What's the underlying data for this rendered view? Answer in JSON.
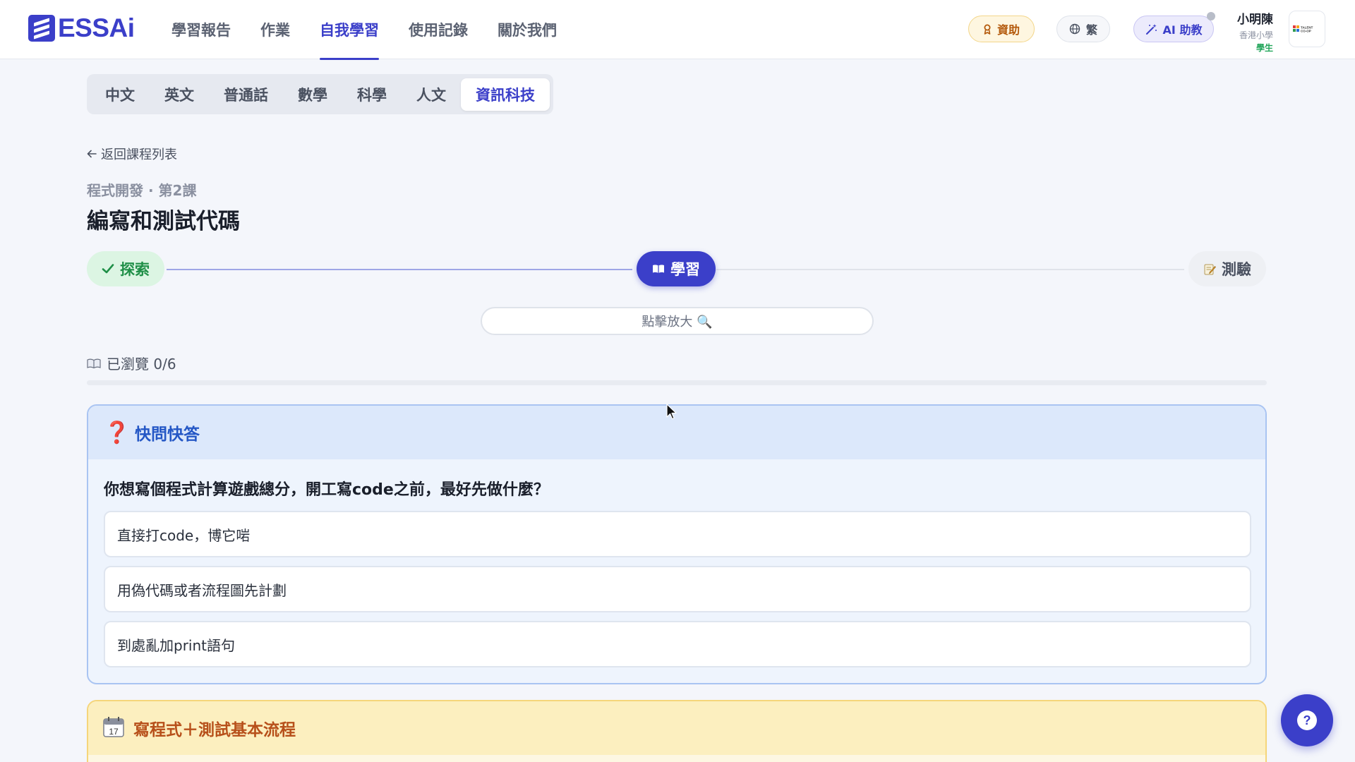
{
  "brand": {
    "logo_text": "ESSAi",
    "accent": "#3b3fc9"
  },
  "nav": {
    "items": [
      {
        "label": "學習報告"
      },
      {
        "label": "作業"
      },
      {
        "label": "自我學習",
        "active": true
      },
      {
        "label": "使用記錄"
      },
      {
        "label": "關於我們"
      }
    ]
  },
  "header_actions": {
    "sponsor_label": "資助",
    "language_label": "繁",
    "ai_tutor_label": "AI 助教"
  },
  "user": {
    "name": "小明陳",
    "school": "香港小學",
    "role": "學生",
    "school_logo_text": "TALENT CO-OP"
  },
  "subject_tabs": [
    {
      "label": "中文"
    },
    {
      "label": "英文"
    },
    {
      "label": "普通話"
    },
    {
      "label": "數學"
    },
    {
      "label": "科學"
    },
    {
      "label": "人文"
    },
    {
      "label": "資訊科技",
      "active": true
    }
  ],
  "lesson": {
    "back_label": "返回課程列表",
    "subtitle": "程式開發 · 第2課",
    "title": "編寫和測試代碼"
  },
  "stepper": {
    "steps": [
      {
        "label": "探索",
        "state": "done",
        "icon": "check-icon"
      },
      {
        "label": "學習",
        "state": "current",
        "icon": "book-icon"
      },
      {
        "label": "測驗",
        "state": "upcoming",
        "icon": "memo-icon"
      }
    ]
  },
  "zoom_label": "點擊放大 🔍",
  "progress": {
    "label": "已瀏覽 0/6",
    "viewed": 0,
    "total": 6
  },
  "quick_quiz": {
    "title": "快問快答",
    "question": "你想寫個程式計算遊戲總分，開工寫code之前，最好先做什麼？",
    "options": [
      "直接打code，博它啱",
      "用偽代碼或者流程圖先計劃",
      "到處亂加print語句"
    ]
  },
  "flow_card": {
    "title": "寫程式＋測試基本流程",
    "icon": "calendar-icon",
    "calendar_day": "17"
  },
  "help_label": "?"
}
